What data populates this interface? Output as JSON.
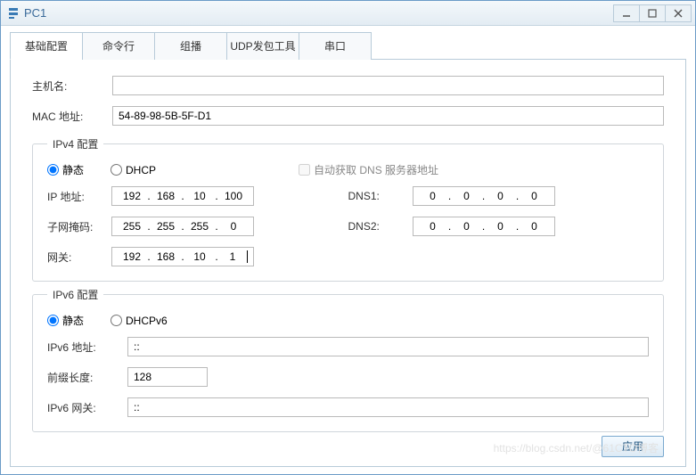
{
  "window": {
    "title": "PC1"
  },
  "tabs": [
    "基础配置",
    "命令行",
    "组播",
    "UDP发包工具",
    "串口"
  ],
  "basic": {
    "hostname_label": "主机名:",
    "hostname_value": "",
    "mac_label": "MAC 地址:",
    "mac_value": "54-89-98-5B-5F-D1"
  },
  "ipv4": {
    "legend": "IPv4 配置",
    "static_label": "静态",
    "dhcp_label": "DHCP",
    "auto_dns_label": "自动获取 DNS 服务器地址",
    "ip_label": "IP 地址:",
    "ip": [
      "192",
      "168",
      "10",
      "100"
    ],
    "mask_label": "子网掩码:",
    "mask": [
      "255",
      "255",
      "255",
      "0"
    ],
    "gw_label": "网关:",
    "gw": [
      "192",
      "168",
      "10",
      "1"
    ],
    "dns1_label": "DNS1:",
    "dns1": [
      "0",
      "0",
      "0",
      "0"
    ],
    "dns2_label": "DNS2:",
    "dns2": [
      "0",
      "0",
      "0",
      "0"
    ]
  },
  "ipv6": {
    "legend": "IPv6 配置",
    "static_label": "静态",
    "dhcp_label": "DHCPv6",
    "addr_label": "IPv6 地址:",
    "addr_value": "::",
    "prefix_label": "前缀长度:",
    "prefix_value": "128",
    "gw_label": "IPv6 网关:",
    "gw_value": "::"
  },
  "apply_label": "应用",
  "watermark": "https://blog.csdn.net/@61CTO博客"
}
